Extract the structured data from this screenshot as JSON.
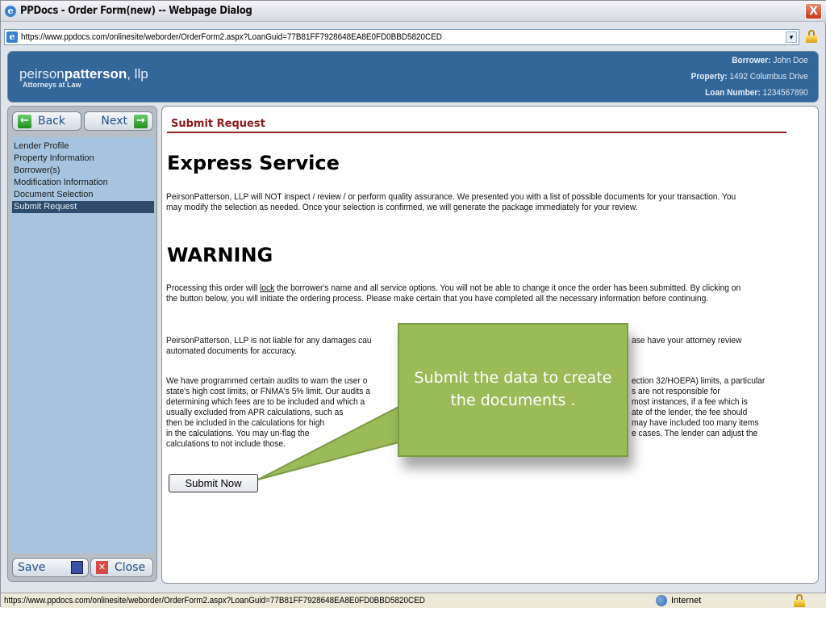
{
  "window": {
    "title": "PPDocs - Order Form(new) -- Webpage Dialog",
    "close": "X"
  },
  "address": {
    "url": "https://www.ppdocs.com/onlinesite/weborder/OrderForm2.aspx?LoanGuid=77B81FF7928648EA8E0FD0BBD5820CED"
  },
  "header": {
    "logo_light": "peirson",
    "logo_bold": "patterson",
    "logo_suffix": ", llp",
    "logo_sub": "Attorneys at Law",
    "borrower_label": "Borrower:",
    "borrower": "John Doe",
    "property_label": "Property:",
    "property": "1492 Columbus Drive",
    "loan_label": "Loan Number:",
    "loan": "1234567890"
  },
  "sidebar": {
    "back": "Back",
    "next": "Next",
    "save": "Save",
    "close": "Close",
    "items": [
      {
        "label": "Lender Profile"
      },
      {
        "label": "Property Information"
      },
      {
        "label": "Borrower(s)"
      },
      {
        "label": "Modification Information"
      },
      {
        "label": "Document Selection"
      },
      {
        "label": "Submit Request",
        "selected": true
      }
    ]
  },
  "main": {
    "section": "Submit Request",
    "heading1": "Express Service",
    "para1": "PeirsonPatterson, LLP will NOT inspect / review / or perform quality assurance. We presented you with a list of possible documents for your transaction. You may modify the selection as needed. Once your selection is confirmed, we will generate the package immediately for your review.",
    "heading2": "WARNING",
    "para2_a": "Processing this order will ",
    "para2_lock": "lock",
    "para2_b": " the borrower's name and all service options. You will not be able to change it once the order has been submitted. By clicking on the button below, you will initiate the ordering process. Please make certain that you have completed all the necessary information before continuing.",
    "para3": [
      {
        "left": "PeirsonPatterson, LLP is not liable for any damages cau",
        "right": "ase have your attorney review"
      },
      {
        "left": "automated documents for accuracy.",
        "right": ""
      }
    ],
    "para4": [
      {
        "left": "We have programmed certain audits to warn the user o",
        "right": "ection 32/HOEPA) limits, a particular"
      },
      {
        "left": "state's high cost limits, or FNMA's 5% limit. Our audits a",
        "right": "s are not responsible for"
      },
      {
        "left": "determining which fees are to be included and which a",
        "right": "most instances, if a fee which is"
      },
      {
        "left": "usually excluded from APR calculations, such as",
        "right": "ate of the lender, the fee should"
      },
      {
        "left": "then be included in the calculations for high",
        "right": "may have included too many items"
      },
      {
        "left": "in the calculations. You may un-flag the",
        "right": "e cases. The lender can adjust the"
      },
      {
        "left": "calculations to not include those.",
        "right": ""
      }
    ],
    "submit": "Submit Now"
  },
  "callout": {
    "text": "Submit the data to create the documents ."
  },
  "status": {
    "url": "https://www.ppdocs.com/onlinesite/weborder/OrderForm2.aspx?LoanGuid=77B81FF7928648EA8E0FD0BBD5820CED",
    "zone": "Internet"
  }
}
